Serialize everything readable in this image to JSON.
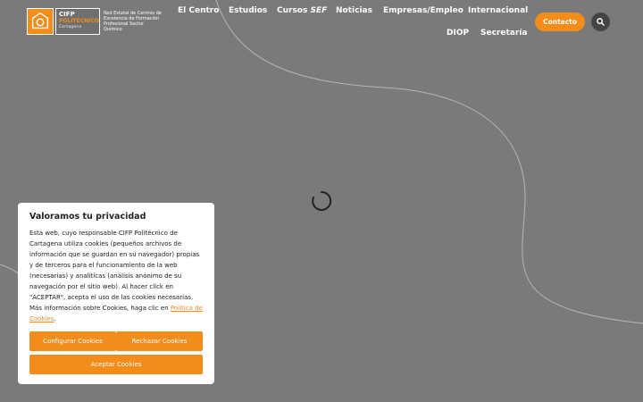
{
  "logo": {
    "line1": "CIFP",
    "line2": "POLITÉCNICO",
    "line3": "Cartagena",
    "tagline": "Red Estatal de Centros de Excelencia de Formación Profesional Sector Químico"
  },
  "nav": {
    "row1": [
      "El Centro",
      "Estudios",
      "Cursos",
      "Noticias",
      "Empresas/Empleo",
      "Internacional"
    ],
    "cursos_suffix": "SEF",
    "row2": [
      "DIOP",
      "Secretaría"
    ],
    "contact_label": "Contacto"
  },
  "icons": {
    "search": "search-icon",
    "spinner": "loading-spinner-icon",
    "logo": "logo-mark-icon"
  },
  "colors": {
    "accent": "#f28c1b",
    "background": "#7a7a7a",
    "search_bg": "#444444"
  },
  "cookie": {
    "title": "Valoramos tu privacidad",
    "body": "Esta web, cuyo responsable CIFP Politécnico de Cartagena utiliza cookies (pequeños archivos de información que se guardan en su navegador) propias y de terceros para el funcionamiento de la web (necesarias) y analíticas (análisis anónimo de su navegación por el sitio web). Al hacer click en \"ACEPTAR\", acepta el uso de las cookies necesarias. Más información sobre Cookies, haga clic en",
    "link": "Política de Cookies",
    "after_link": ".",
    "configure": "Configurar Cookies",
    "reject": "Rechazar Cookies",
    "accept": "Aceptar Cookies"
  }
}
